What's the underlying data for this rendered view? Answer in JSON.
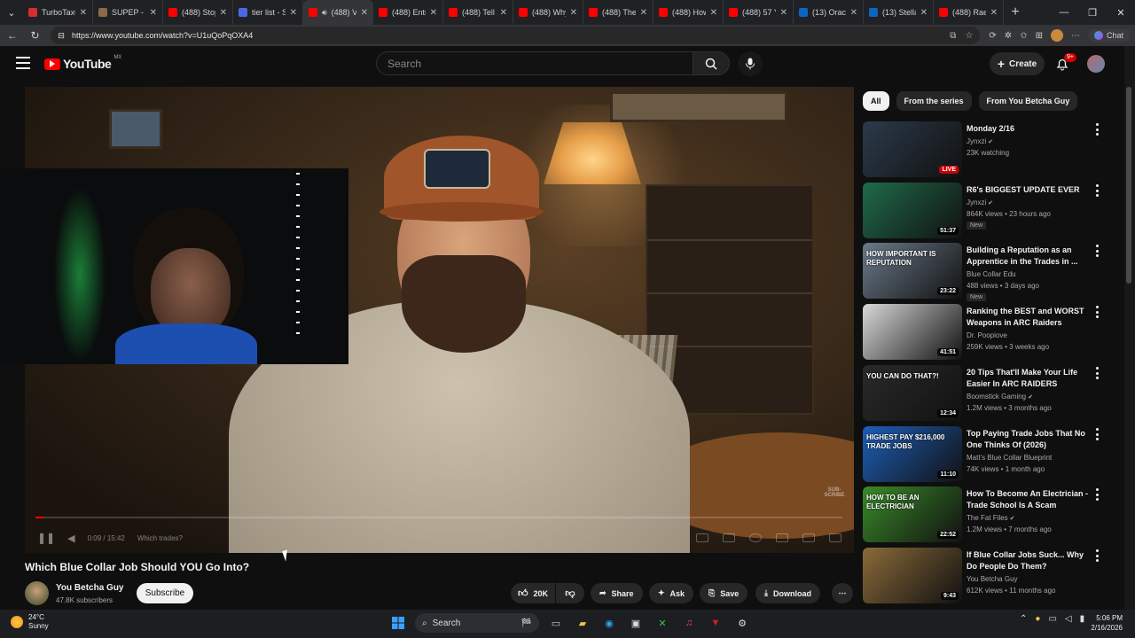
{
  "browser": {
    "tabs": [
      {
        "title": "TurboTax®",
        "fav_color": "#d42e2e",
        "active": false
      },
      {
        "title": "SUPEP - Ing",
        "fav_color": "#8a6a4a",
        "active": false
      },
      {
        "title": "(488) Stop",
        "fav_color": "#ff0000",
        "active": false
      },
      {
        "title": "tier list - Se",
        "fav_color": "#4a6adf",
        "active": false
      },
      {
        "title": "(488) V",
        "fav_color": "#ff0000",
        "active": true
      },
      {
        "title": "(488) Entry",
        "fav_color": "#ff0000",
        "active": false
      },
      {
        "title": "(488) Tell M",
        "fav_color": "#ff0000",
        "active": false
      },
      {
        "title": "(488) Why",
        "fav_color": "#ff0000",
        "active": false
      },
      {
        "title": "(488) The B",
        "fav_color": "#ff0000",
        "active": false
      },
      {
        "title": "(488) How",
        "fav_color": "#ff0000",
        "active": false
      },
      {
        "title": "(488) 57 Ye",
        "fav_color": "#ff0000",
        "active": false
      },
      {
        "title": "(13) Oracle",
        "fav_color": "#0a66c2",
        "active": false
      },
      {
        "title": "(13) Stellan",
        "fav_color": "#0a66c2",
        "active": false
      },
      {
        "title": "(488) Rae S",
        "fav_color": "#ff0000",
        "active": false
      }
    ],
    "url": "https://www.youtube.com/watch?v=U1uQoPqOXA4",
    "chat_label": "Chat"
  },
  "header": {
    "logo_text": "YouTube",
    "logo_country": "MX",
    "search_placeholder": "Search",
    "create_label": "Create",
    "notif_badge": "9+"
  },
  "player": {
    "time": "0:09 / 15:42",
    "chapter": "Which trades?",
    "progress": 0.01,
    "corner_text": "SUB-SCRIBE"
  },
  "video": {
    "title": "Which Blue Collar Job Should YOU Go Into?",
    "channel": "You Betcha Guy",
    "subscribers": "47.8K subscribers",
    "subscribe_label": "Subscribe",
    "likes": "20K",
    "share_label": "Share",
    "ask_label": "Ask",
    "save_label": "Save",
    "download_label": "Download"
  },
  "chips": [
    "All",
    "From the series",
    "From You Betcha Guy"
  ],
  "recommendations": [
    {
      "title": "Monday 2/16",
      "channel": "Jynxzi",
      "verified": true,
      "meta": "23K watching",
      "badge": "LIVE",
      "duration": "",
      "tag": "",
      "thumb": "#2b3a4a",
      "thumb_text": ""
    },
    {
      "title": "R6's BIGGEST UPDATE EVER",
      "channel": "Jynxzi",
      "verified": true,
      "meta": "864K views • 23 hours ago",
      "badge": "",
      "duration": "51:37",
      "tag": "New",
      "thumb": "#1f6a4a",
      "thumb_text": ""
    },
    {
      "title": "Building a Reputation as an Apprentice in the Trades in ...",
      "channel": "Blue Collar Edu",
      "verified": false,
      "meta": "488 views • 3 days ago",
      "badge": "",
      "duration": "23:22",
      "tag": "New",
      "thumb": "#6a7a8a",
      "thumb_text": "HOW IMPORTANT IS REPUTATION"
    },
    {
      "title": "Ranking the BEST and WORST Weapons in ARC Raiders",
      "channel": "Dr. Poopiove",
      "verified": false,
      "meta": "259K views • 3 weeks ago",
      "badge": "",
      "duration": "41:51",
      "tag": "",
      "thumb": "#d8d8d8",
      "thumb_text": ""
    },
    {
      "title": "20 Tips That'll Make Your Life Easier In ARC RAIDERS",
      "channel": "Boomstick Gaming",
      "verified": true,
      "meta": "1.2M views • 3 months ago",
      "badge": "",
      "duration": "12:34",
      "tag": "",
      "thumb": "#2a2a2a",
      "thumb_text": "YOU CAN DO THAT?!"
    },
    {
      "title": "Top Paying Trade Jobs That No One Thinks Of (2026)",
      "channel": "Matt's Blue Collar Blueprint",
      "verified": false,
      "meta": "74K views • 1 month ago",
      "badge": "",
      "duration": "11:10",
      "tag": "",
      "thumb": "#1d5fb8",
      "thumb_text": "HIGHEST PAY $216,000 TRADE JOBS"
    },
    {
      "title": "How To Become An Electrician - Trade School Is A Scam",
      "channel": "The Fat Files",
      "verified": true,
      "meta": "1.2M views • 7 months ago",
      "badge": "",
      "duration": "22:52",
      "tag": "",
      "thumb": "#3a8a2a",
      "thumb_text": "HOW TO BE AN ELECTRICIAN"
    },
    {
      "title": "If Blue Collar Jobs Suck... Why Do People Do Them?",
      "channel": "You Betcha Guy",
      "verified": false,
      "meta": "612K views • 11 months ago",
      "badge": "",
      "duration": "9:43",
      "tag": "",
      "thumb": "#8a6a3a",
      "thumb_text": ""
    }
  ],
  "taskbar": {
    "temp": "24°C",
    "condition": "Sunny",
    "search_label": "Search",
    "time": "5:06 PM",
    "date": "2/16/2026"
  }
}
